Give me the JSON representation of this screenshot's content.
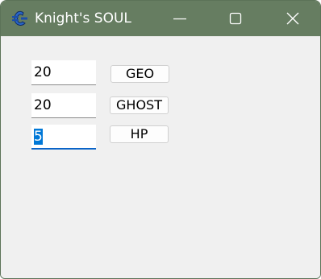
{
  "window": {
    "title": "Knight's SOUL",
    "icon": "cheat-engine-icon",
    "titlebar_color": "#667d61",
    "controls": [
      "minimize-icon",
      "maximize-icon",
      "close-icon"
    ]
  },
  "rows": [
    {
      "field_value": "20",
      "button_label": "GEO"
    },
    {
      "field_value": "20",
      "button_label": "GHOST"
    },
    {
      "field_value": "5",
      "button_label": "HP"
    }
  ],
  "focused_field": "hp",
  "accent_color": "#0078d7"
}
